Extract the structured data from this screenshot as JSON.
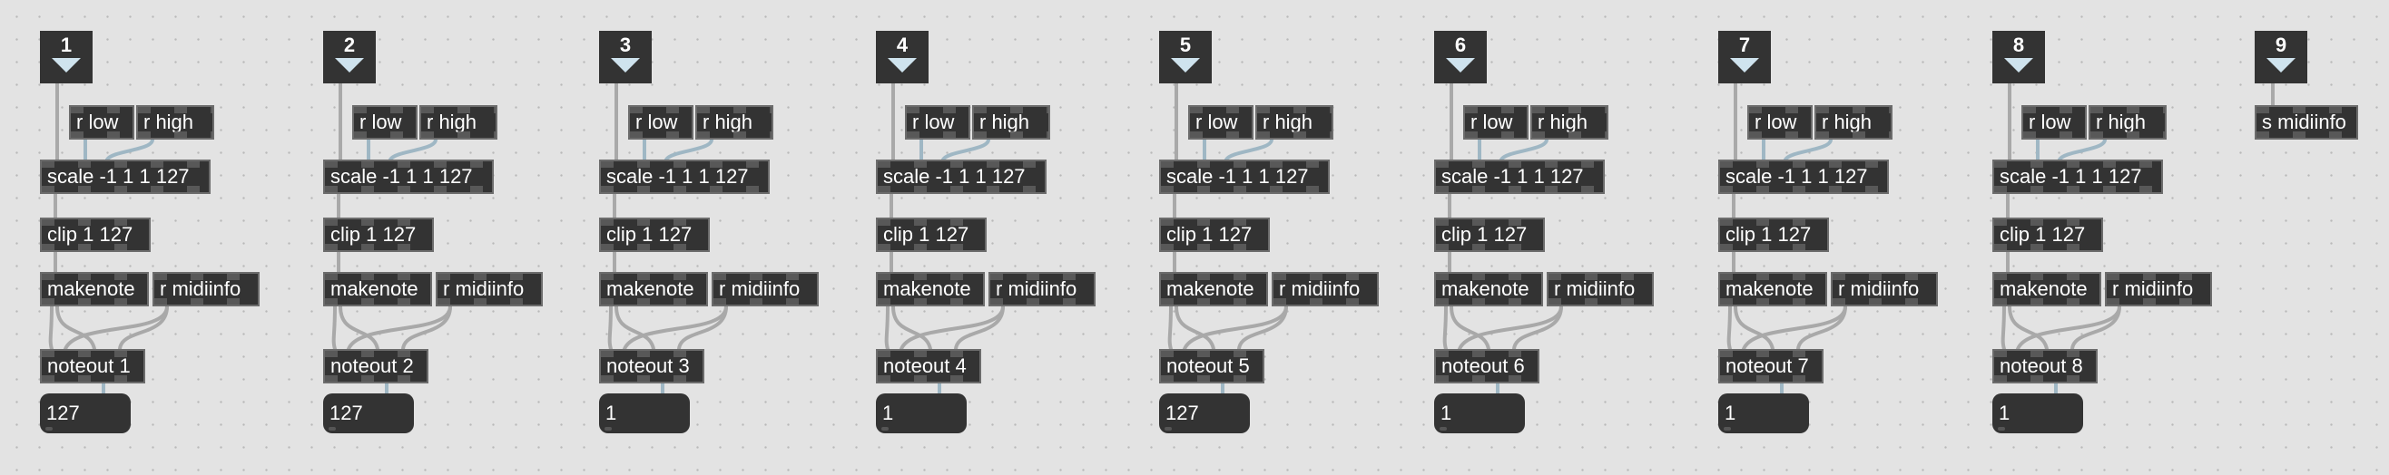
{
  "accent_colors": {
    "patchcord": "#a9a9a9",
    "object_box": "#333333",
    "canvas": "#e3e3e3",
    "message_triangle": "#cfe3ee"
  },
  "columns": [
    {
      "message": "1",
      "scale": "scale -1 1 1 127",
      "clip": "clip 1 127",
      "makenote": "makenote",
      "r_midiinfo": "r midiinfo",
      "noteout": "noteout 1",
      "number": "127",
      "r_low": "r low",
      "r_high": "r high"
    },
    {
      "message": "2",
      "scale": "scale -1 1 1 127",
      "clip": "clip 1 127",
      "makenote": "makenote",
      "r_midiinfo": "r midiinfo",
      "noteout": "noteout 2",
      "number": "127",
      "r_low": "r low",
      "r_high": "r high"
    },
    {
      "message": "3",
      "scale": "scale -1 1 1 127",
      "clip": "clip 1 127",
      "makenote": "makenote",
      "r_midiinfo": "r midiinfo",
      "noteout": "noteout 3",
      "number": "1",
      "r_low": "r low",
      "r_high": "r high"
    },
    {
      "message": "4",
      "scale": "scale -1 1 1 127",
      "clip": "clip 1 127",
      "makenote": "makenote",
      "r_midiinfo": "r midiinfo",
      "noteout": "noteout 4",
      "number": "1",
      "r_low": "r low",
      "r_high": "r high"
    },
    {
      "message": "5",
      "scale": "scale -1 1 1 127",
      "clip": "clip 1 127",
      "makenote": "makenote",
      "r_midiinfo": "r midiinfo",
      "noteout": "noteout 5",
      "number": "127",
      "r_low": "r low",
      "r_high": "r high"
    },
    {
      "message": "6",
      "scale": "scale -1 1 1 127",
      "clip": "clip 1 127",
      "makenote": "makenote",
      "r_midiinfo": "r midiinfo",
      "noteout": "noteout 6",
      "number": "1",
      "r_low": "r low",
      "r_high": "r high"
    },
    {
      "message": "7",
      "scale": "scale -1 1 1 127",
      "clip": "clip 1 127",
      "makenote": "makenote",
      "r_midiinfo": "r midiinfo",
      "noteout": "noteout 7",
      "number": "1",
      "r_low": "r low",
      "r_high": "r high"
    },
    {
      "message": "8",
      "scale": "scale -1 1 1 127",
      "clip": "clip 1 127",
      "makenote": "makenote",
      "r_midiinfo": "r midiinfo",
      "noteout": "noteout 8",
      "number": "1",
      "r_low": "r low",
      "r_high": "r high"
    }
  ],
  "extra": {
    "message": "9",
    "send": "s midiinfo"
  }
}
